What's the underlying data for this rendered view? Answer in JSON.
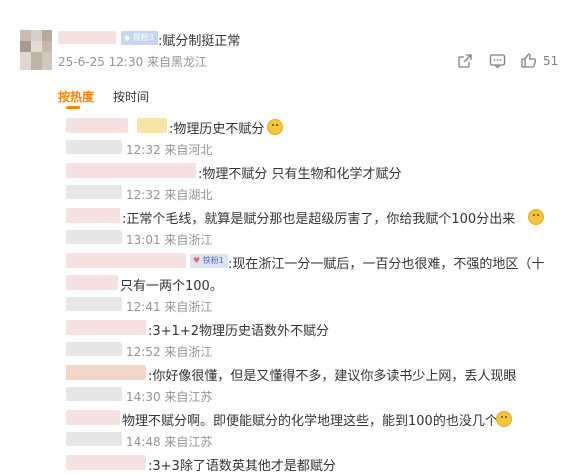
{
  "post": {
    "fan_badge": "铁粉3",
    "text": ":赋分制挺正常",
    "meta": "25-6-25 12:30 来自黑龙江",
    "like_count": "51"
  },
  "sort_tabs": [
    {
      "label": "按热度",
      "active": true
    },
    {
      "label": "按时间",
      "active": false
    }
  ],
  "replies": [
    {
      "text": ":物理历史不赋分",
      "meta": "12:32 来自河北"
    },
    {
      "text": ":物理不赋分 只有生物和化学才赋分",
      "meta": "12:32 来自湖北"
    },
    {
      "text": ":正常个毛线，就算是赋分那也是超级厉害了，你给我赋个100分出来",
      "meta": "13:01 来自浙江"
    },
    {
      "fan_badge": "铁粉1",
      "text": ":现在浙江一分一赋后，一百分也很难，不强的地区（十",
      "text_cont": "只有一两个100。",
      "meta": "12:41 来自浙江"
    },
    {
      "text": ":3+1+2物理历史语数外不赋分",
      "meta": "12:52 来自浙江"
    },
    {
      "text": ":你好像很懂，但是又懂得不多，建议你多读书少上网，丢人现眼",
      "meta": "14:30 来自江苏"
    },
    {
      "text": "物理不赋分啊。即便能赋分的化学地理这些，能到100的也没几个",
      "meta": "14:48 来自江苏"
    },
    {
      "text": ":3+3除了语数英其他才是都赋分"
    }
  ],
  "colors": {
    "accent": "#ff8200",
    "meta": "#939393",
    "text": "#333333"
  },
  "icons": [
    "share-icon",
    "comment-icon",
    "like-icon",
    "smile-emoji",
    "laugh-emoji"
  ]
}
